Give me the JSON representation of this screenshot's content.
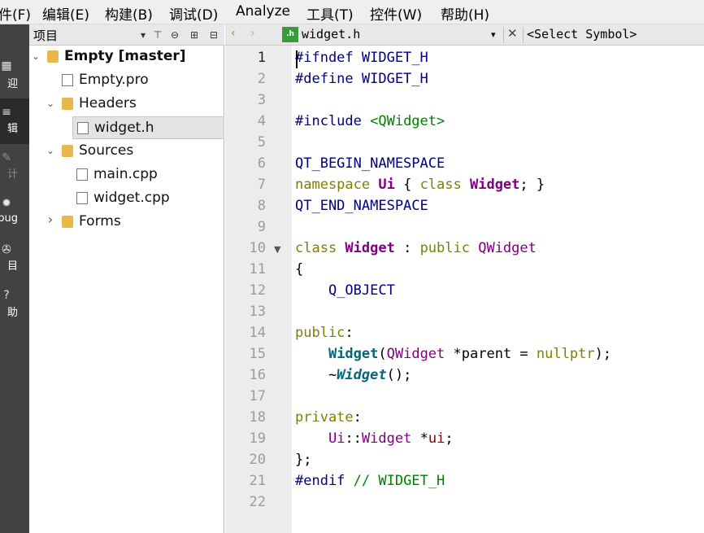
{
  "menu": [
    {
      "key": "file",
      "label": "件(F)"
    },
    {
      "key": "edit",
      "label": "编辑(E)"
    },
    {
      "key": "build",
      "label": "构建(B)"
    },
    {
      "key": "debug",
      "label": "调试(D)"
    },
    {
      "key": "analyze",
      "label": "Analyze"
    },
    {
      "key": "tools",
      "label": "工具(T)"
    },
    {
      "key": "controls",
      "label": "控件(W)"
    },
    {
      "key": "help",
      "label": "帮助(H)"
    }
  ],
  "modes": [
    {
      "key": "welcome",
      "label": "迎",
      "icon": "grid-icon",
      "glyph": "▦"
    },
    {
      "key": "edit",
      "label": "辑",
      "icon": "edit-icon",
      "glyph": "≡",
      "active": true
    },
    {
      "key": "design",
      "label": "计",
      "icon": "pencil-icon",
      "glyph": "✎",
      "dim": true
    },
    {
      "key": "debug",
      "label": "bug",
      "icon": "bug-icon",
      "glyph": "✹"
    },
    {
      "key": "projects",
      "label": "目",
      "icon": "wrench-icon",
      "glyph": "✇"
    },
    {
      "key": "help",
      "label": "助",
      "icon": "help-icon",
      "glyph": "?"
    }
  ],
  "project_panel": {
    "title": "项目",
    "tree": [
      {
        "key": "empty",
        "label": "Empty [master]",
        "icon": "project-folder-icon",
        "bold": true,
        "chevron": "v",
        "level": 0
      },
      {
        "key": "empty-pro",
        "label": "Empty.pro",
        "icon": "pro-file-icon",
        "level": 1
      },
      {
        "key": "headers",
        "label": "Headers",
        "icon": "headers-folder-icon",
        "chevron": "v",
        "level": 1
      },
      {
        "key": "widget-h",
        "label": "widget.h",
        "icon": "header-file-icon",
        "level": 2,
        "selected": true
      },
      {
        "key": "sources",
        "label": "Sources",
        "icon": "sources-folder-icon",
        "chevron": "v",
        "level": 1
      },
      {
        "key": "main-cpp",
        "label": "main.cpp",
        "icon": "cpp-file-icon",
        "level": 2
      },
      {
        "key": "widget-cpp",
        "label": "widget.cpp",
        "icon": "cpp-file-icon",
        "level": 2
      },
      {
        "key": "forms",
        "label": "Forms",
        "icon": "forms-folder-icon",
        "chevron": ">",
        "level": 1
      }
    ]
  },
  "editor": {
    "file_name": "widget.h",
    "symbol_placeholder": "<Select Symbol>",
    "current_line": 1,
    "fold_marker_line": 10,
    "lines": [
      [
        {
          "t": "#ifndef WIDGET_H",
          "c": "pp"
        }
      ],
      [
        {
          "t": "#define WIDGET_H",
          "c": "pp"
        }
      ],
      [],
      [
        {
          "t": "#include ",
          "c": "pp"
        },
        {
          "t": "<QWidget>",
          "c": "str"
        }
      ],
      [],
      [
        {
          "t": "QT_BEGIN_NAMESPACE",
          "c": "pp"
        }
      ],
      [
        {
          "t": "namespace ",
          "c": "kw"
        },
        {
          "t": "Ui",
          "c": "cls"
        },
        {
          "t": " { ",
          "c": "pl"
        },
        {
          "t": "class ",
          "c": "kw"
        },
        {
          "t": "Widget",
          "c": "cls"
        },
        {
          "t": "; }",
          "c": "pl"
        }
      ],
      [
        {
          "t": "QT_END_NAMESPACE",
          "c": "pp"
        }
      ],
      [],
      [
        {
          "t": "class ",
          "c": "kw"
        },
        {
          "t": "Widget",
          "c": "cls"
        },
        {
          "t": " : ",
          "c": "pl"
        },
        {
          "t": "public ",
          "c": "kw"
        },
        {
          "t": "QWidget",
          "c": "qt"
        }
      ],
      [
        {
          "t": "{",
          "c": "pl"
        }
      ],
      [
        {
          "t": "    ",
          "c": "pl"
        },
        {
          "t": "Q_OBJECT",
          "c": "pp"
        }
      ],
      [],
      [
        {
          "t": "public",
          "c": "kw"
        },
        {
          "t": ":",
          "c": "pl"
        }
      ],
      [
        {
          "t": "    ",
          "c": "pl"
        },
        {
          "t": "Widget",
          "c": "fn"
        },
        {
          "t": "(",
          "c": "pl"
        },
        {
          "t": "QWidget",
          "c": "qt"
        },
        {
          "t": " *",
          "c": "pl"
        },
        {
          "t": "parent",
          "c": "pl"
        },
        {
          "t": " = ",
          "c": "pl"
        },
        {
          "t": "nullptr",
          "c": "kw"
        },
        {
          "t": ");",
          "c": "pl"
        }
      ],
      [
        {
          "t": "    ~",
          "c": "pl"
        },
        {
          "t": "Widget",
          "c": "fni"
        },
        {
          "t": "();",
          "c": "pl"
        }
      ],
      [],
      [
        {
          "t": "private",
          "c": "kw"
        },
        {
          "t": ":",
          "c": "pl"
        }
      ],
      [
        {
          "t": "    ",
          "c": "pl"
        },
        {
          "t": "Ui",
          "c": "qt"
        },
        {
          "t": "::",
          "c": "pl"
        },
        {
          "t": "Widget",
          "c": "qt"
        },
        {
          "t": " *",
          "c": "pl"
        },
        {
          "t": "ui",
          "c": "mem"
        },
        {
          "t": ";",
          "c": "pl"
        }
      ],
      [
        {
          "t": "};",
          "c": "pl"
        }
      ],
      [
        {
          "t": "#endif ",
          "c": "pp"
        },
        {
          "t": "// WIDGET_H",
          "c": "com"
        }
      ],
      []
    ]
  }
}
